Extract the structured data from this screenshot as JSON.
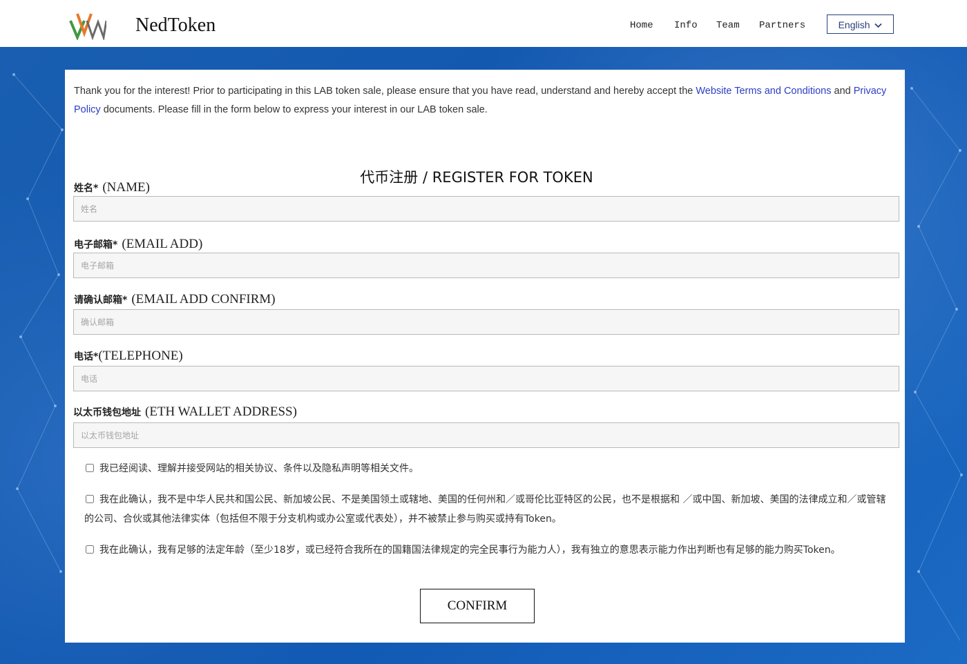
{
  "brand": {
    "name": "NedToken",
    "logo_icon": "vw-logo-icon"
  },
  "nav": {
    "items": [
      "Home",
      "Info",
      "Team",
      "Partners"
    ]
  },
  "language": {
    "selected": "English",
    "icon": "chevron-down-icon"
  },
  "intro": {
    "before": "Thank you for the interest! Prior to participating in this LAB token sale, please ensure that you have read, understand and hereby accept the ",
    "terms_link": "Website Terms and Conditions",
    "middle": " and ",
    "privacy_link": "Privacy Policy",
    "after": " documents. Please fill in the form below to express your interest in our LAB token sale."
  },
  "form": {
    "title": "代币注册 / REGISTER FOR TOKEN",
    "fields": [
      {
        "label_cn": "姓名*",
        "label_en": "(NAME)",
        "placeholder": "姓名",
        "value": ""
      },
      {
        "label_cn": "电子邮箱*",
        "label_en": "(EMAIL ADD)",
        "placeholder": "电子邮箱",
        "value": ""
      },
      {
        "label_cn": "请确认邮箱*",
        "label_en": "(EMAIL ADD CONFIRM)",
        "placeholder": "确认邮箱",
        "value": ""
      },
      {
        "label_cn": "电话*",
        "label_en": "(TELEPHONE)",
        "placeholder": "电话",
        "value": ""
      },
      {
        "label_cn": "以太币钱包地址",
        "label_en": "(ETH WALLET ADDRESS)",
        "placeholder": "以太币钱包地址",
        "value": ""
      }
    ],
    "checkboxes": [
      {
        "checked": false,
        "text": "我已经阅读、理解并接受网站的相关协议、条件以及隐私声明等相关文件。"
      },
      {
        "checked": false,
        "text": "我在此确认，我不是中华人民共和国公民、新加坡公民、不是美国领土或辖地、美国的任何州和／或哥伦比亚特区的公民，也不是根据和 ／或中国、新加坡、美国的法律成立和／或管辖的公司、合伙或其他法律实体（包括但不限于分支机构或办公室或代表处），并不被禁止参与购买或持有Token。"
      },
      {
        "checked": false,
        "text": "我在此确认，我有足够的法定年龄（至少18岁，或已经符合我所在的国籍国法律规定的完全民事行为能力人），我有独立的意思表示能力作出判断也有足够的能力购买Token。"
      }
    ],
    "confirm_label": "CONFIRM"
  },
  "colors": {
    "background": "#1560b8",
    "link": "#2b3ec4",
    "lang_border": "#2a3f7a"
  }
}
